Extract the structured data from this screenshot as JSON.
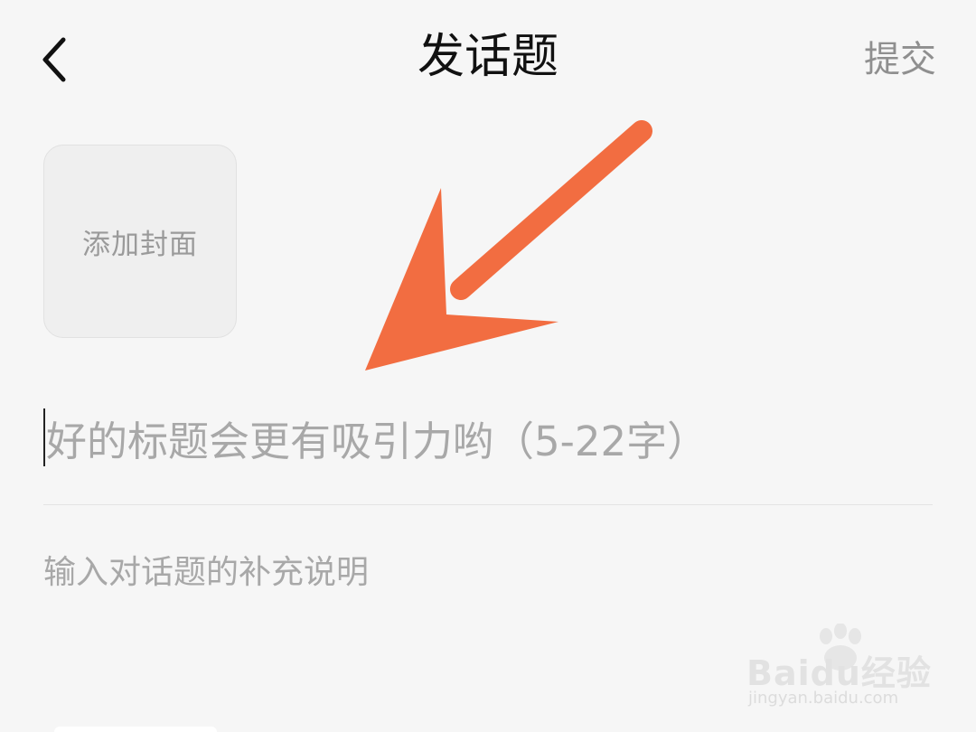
{
  "header": {
    "title": "发话题",
    "submit_label": "提交",
    "back_icon": "chevron-left-icon"
  },
  "cover": {
    "label": "添加封面"
  },
  "title_field": {
    "placeholder": "好的标题会更有吸引力哟（5-22字）",
    "value": ""
  },
  "description_field": {
    "placeholder": "输入对话题的补充说明",
    "value": ""
  },
  "annotation": {
    "icon": "arrow-icon",
    "color": "#F26D41"
  },
  "watermark": {
    "brand": "Baidu经验",
    "url": "jingyan.baidu.com"
  }
}
